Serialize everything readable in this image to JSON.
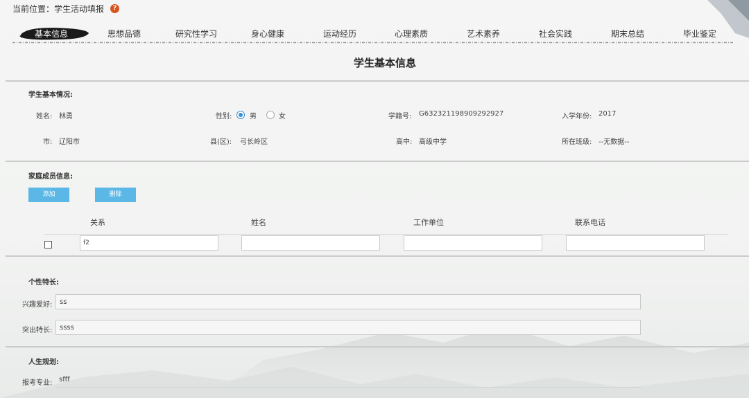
{
  "breadcrumb": {
    "prefix": "当前位置：",
    "current": "学生活动填报",
    "help": "?"
  },
  "tabs": [
    {
      "label": "基本信息",
      "active": true
    },
    {
      "label": "思想品德"
    },
    {
      "label": "研究性学习"
    },
    {
      "label": "身心健康"
    },
    {
      "label": "运动经历"
    },
    {
      "label": "心理素质"
    },
    {
      "label": "艺术素养"
    },
    {
      "label": "社会实践"
    },
    {
      "label": "期末总结"
    },
    {
      "label": "毕业鉴定"
    }
  ],
  "page_title": "学生基本信息",
  "basic": {
    "section_label": "学生基本情况:",
    "name_label": "姓名:",
    "name_value": "林勇",
    "gender_label": "性别:",
    "gender_male": "男",
    "gender_female": "女",
    "gender_selected": "male",
    "student_no_label": "学籍号:",
    "student_no_value": "G632321198909292927",
    "enroll_year_label": "入学年份:",
    "enroll_year_value": "2017",
    "city_label": "市:",
    "city_value": "辽阳市",
    "county_label": "县(区):",
    "county_value": "弓长岭区",
    "school_label": "高中:",
    "school_value": "高级中学",
    "class_label": "所在班级:",
    "class_value": "--无数据--"
  },
  "family": {
    "section_label": "家庭成员信息:",
    "add_button": "添加",
    "delete_button": "删除",
    "columns": [
      "关系",
      "姓名",
      "工作单位",
      "联系电话"
    ],
    "rows": [
      {
        "relation": "f2",
        "name": "",
        "work": "",
        "phone": ""
      }
    ]
  },
  "personality": {
    "section_label": "个性特长:",
    "hobby_label": "兴趣爱好:",
    "hobby_value": "ss",
    "talent_label": "突出特长:",
    "talent_value": "ssss"
  },
  "life_plan": {
    "section_label": "人生规划:",
    "major_label": "报考专业:",
    "major_value": "sfff"
  },
  "colors": {
    "accent": "#5bb7e6",
    "radio": "#3a8fd0",
    "help": "#d9541e",
    "brush": "#1a1a1a"
  }
}
